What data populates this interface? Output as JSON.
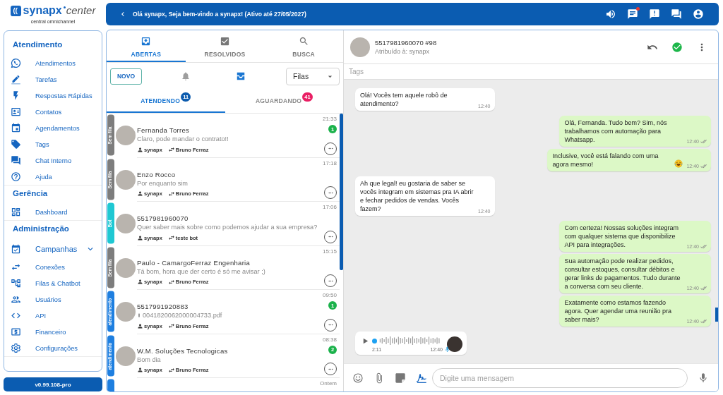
{
  "logo": {
    "name": "synapx",
    "suffix": "center",
    "tagline": "central omnichannel"
  },
  "sidebar": {
    "sections": [
      {
        "title": "Atendimento",
        "items": [
          {
            "label": "Atendimentos",
            "kind": "link"
          },
          {
            "label": "Tarefas",
            "kind": "link"
          },
          {
            "label": "Respostas Rápidas",
            "kind": "link"
          },
          {
            "label": "Contatos",
            "kind": "link"
          },
          {
            "label": "Agendamentos",
            "kind": "link"
          },
          {
            "label": "Tags",
            "kind": "link"
          },
          {
            "label": "Chat Interno",
            "kind": "link"
          },
          {
            "label": "Ajuda",
            "kind": "link"
          }
        ]
      },
      {
        "title": "Gerência",
        "items": [
          {
            "label": "Dashboard",
            "kind": "link"
          }
        ]
      },
      {
        "title": "Administração",
        "items": [
          {
            "label": "Campanhas",
            "kind": "group",
            "expanded": false
          },
          {
            "label": "Conexões",
            "kind": "link"
          },
          {
            "label": "Filas & Chatbot",
            "kind": "link"
          },
          {
            "label": "Usuários",
            "kind": "link"
          },
          {
            "label": "API",
            "kind": "link"
          },
          {
            "label": "Financeiro",
            "kind": "link"
          },
          {
            "label": "Configurações",
            "kind": "link"
          }
        ]
      }
    ]
  },
  "version": "v0.99.108-pro",
  "top_bar": {
    "title": "Olá synapx, Seja bem-vindo a synapx! (Ativo até 27/05/2027)",
    "chat_notification": true
  },
  "ticket_panel": {
    "tabs": [
      {
        "label": "ABERTAS",
        "selected": true
      },
      {
        "label": "RESOLVIDOS",
        "selected": false
      },
      {
        "label": "BUSCA",
        "selected": false
      }
    ],
    "new_button": "NOVO",
    "queue_select": "Filas",
    "subtabs": [
      {
        "label": "ATENDENDO",
        "selected": true,
        "badge": "11",
        "color": "#0d5cae"
      },
      {
        "label": "AGUARDANDO",
        "selected": false,
        "badge": "41",
        "color": "#e91e63"
      }
    ],
    "tickets": [
      {
        "tag": "Sem fila",
        "color": "#7d7d7d",
        "name": "Fernanda Torres",
        "message": "Claro, pode mandar o contrato!!",
        "attachment": false,
        "user": "synapx",
        "connection": "Bruno Ferraz",
        "time": "21:33",
        "unread": "1"
      },
      {
        "tag": "Sem fila",
        "color": "#7d7d7d",
        "name": "Enzo Rocco",
        "message": "Por enquanto sim",
        "attachment": false,
        "user": "synapx",
        "connection": "Bruno Ferraz",
        "time": "17:18"
      },
      {
        "tag": "Bot",
        "color": "#1fc8d3",
        "name": "5517981960070",
        "message": "Quer saber mais sobre como podemos ajudar a sua empresa?",
        "attachment": false,
        "user": "synapx",
        "connection": "teste bot",
        "time": "17:06"
      },
      {
        "tag": "Sem fila",
        "color": "#7d7d7d",
        "name": "Paulo - CamargoFerraz Engenharia",
        "message": "Tá bom, hora que der certo é só me avisar ;)",
        "attachment": false,
        "user": "synapx",
        "connection": "Bruno Ferraz",
        "time": "15:15"
      },
      {
        "tag": "atendimento",
        "color": "#1e7fe0",
        "name": "5517991920883",
        "message": "0041820062000004733.pdf",
        "attachment": true,
        "user": "synapx",
        "connection": "Bruno Ferraz",
        "time": "09:50",
        "unread": "1"
      },
      {
        "tag": "atendimento",
        "color": "#1e7fe0",
        "name": "W.M. Soluções Tecnologicas",
        "message": "Bom dia",
        "attachment": false,
        "user": "synapx",
        "connection": "Bruno Ferraz",
        "time": "08:38",
        "unread": "2"
      },
      {
        "color": "#1e7fe0",
        "time": "Ontem"
      }
    ]
  },
  "chat": {
    "contact": "5517981960070 #98",
    "assigned": "Atribuído à: synapx",
    "tags_placeholder": "Tags",
    "messages": [
      {
        "kind": "text",
        "outgoing": false,
        "text": "Olá! Vocês tem aquele robô de atendimento?",
        "emoji": false,
        "time": "12:40",
        "delivered": false
      },
      {
        "kind": "text",
        "outgoing": true,
        "text": "Olá, Fernanda. Tudo bem? Sim, nós trabalhamos com automação para Whatsapp.",
        "emoji": false,
        "time": "12:40",
        "delivered": true
      },
      {
        "kind": "text",
        "outgoing": true,
        "text": "Inclusive, você está falando com uma agora mesmo!",
        "emoji": true,
        "time": "12:40",
        "delivered": true
      },
      {
        "kind": "text",
        "outgoing": false,
        "text": "Ah que legal! eu gostaria de saber se vocês integram em sistemas pra IA abrir e fechar pedidos de vendas. Vocês fazem?",
        "emoji": false,
        "time": "12:40",
        "delivered": false
      },
      {
        "kind": "text",
        "outgoing": true,
        "text": "Com certeza! Nossas soluções integram com qualquer sistema que disponibilize API para integrações.",
        "emoji": false,
        "time": "12:40",
        "delivered": true
      },
      {
        "kind": "text",
        "outgoing": true,
        "text": "Sua automação pode realizar pedidos, consultar estoques, consultar débitos e gerar links de pagamentos. Tudo durante a conversa com seu cliente.",
        "emoji": false,
        "time": "12:40",
        "delivered": true
      },
      {
        "kind": "text",
        "outgoing": true,
        "text": "Exatamente como estamos fazendo agora. Quer agendar uma reunião pra saber mais?",
        "emoji": false,
        "time": "12:40",
        "delivered": true
      },
      {
        "kind": "audio",
        "outgoing": false,
        "duration": "2:11",
        "time": "12:40",
        "level": 0
      }
    ],
    "composer_placeholder": "Digite uma mensagem"
  }
}
